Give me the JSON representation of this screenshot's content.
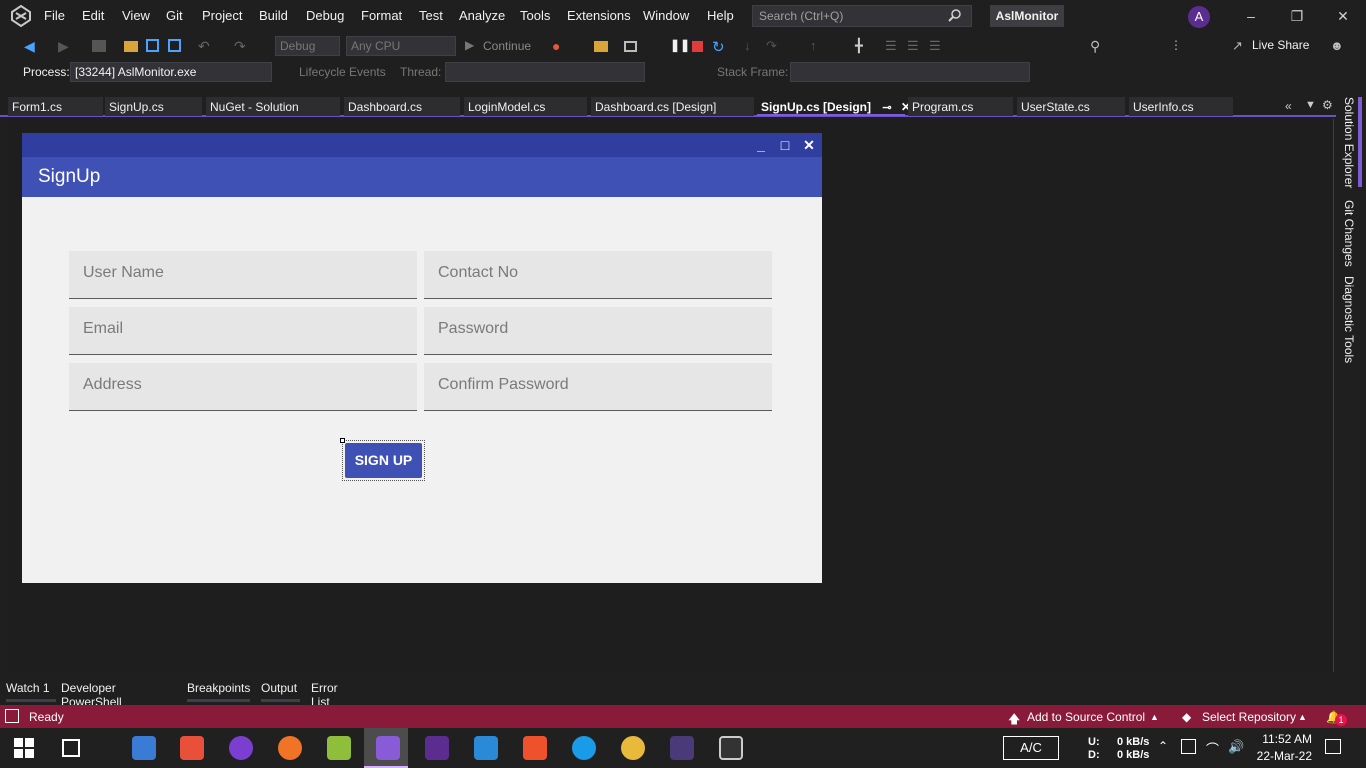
{
  "menu": {
    "items": [
      "File",
      "Edit",
      "View",
      "Git",
      "Project",
      "Build",
      "Debug",
      "Format",
      "Test",
      "Analyze",
      "Tools",
      "Extensions",
      "Window",
      "Help"
    ],
    "search_placeholder": "Search (Ctrl+Q)",
    "solution_name": "AslMonitor",
    "avatar_letter": "A"
  },
  "toolbar": {
    "config": "Debug",
    "platform": "Any CPU",
    "continue_label": "Continue",
    "live_share": "Live Share"
  },
  "debug_toolbar": {
    "process_label": "Process:",
    "process_value": "[33244] AslMonitor.exe",
    "lifecycle_label": "Lifecycle Events",
    "thread_label": "Thread:",
    "stack_label": "Stack Frame:"
  },
  "tabs": [
    {
      "label": "Form1.cs"
    },
    {
      "label": "SignUp.cs"
    },
    {
      "label": "NuGet - Solution"
    },
    {
      "label": "Dashboard.cs"
    },
    {
      "label": "LoginModel.cs"
    },
    {
      "label": "Dashboard.cs [Design]"
    },
    {
      "label": "SignUp.cs [Design]"
    },
    {
      "label": "Program.cs"
    },
    {
      "label": "UserState.cs"
    },
    {
      "label": "UserInfo.cs"
    }
  ],
  "form": {
    "title": "SignUp",
    "fields": {
      "username": "User Name",
      "contact": "Contact No",
      "email": "Email",
      "password": "Password",
      "address": "Address",
      "confirm_password": "Confirm Password"
    },
    "signup_button": "SIGN UP"
  },
  "side_panels": [
    "Solution Explorer",
    "Git Changes",
    "Diagnostic Tools"
  ],
  "bottom_tabs": [
    "Watch 1",
    "Developer PowerShell",
    "Breakpoints",
    "Output",
    "Error List"
  ],
  "status": {
    "text": "Ready",
    "source_control": "Add to Source Control",
    "repository": "Select Repository",
    "notifications": "1"
  },
  "taskbar": {
    "keyboard": "A/C",
    "upload_label": "U:",
    "download_label": "D:",
    "upload_rate": "0 kB/s",
    "download_rate": "0 kB/s",
    "time": "11:52 AM",
    "date": "22-Mar-22"
  },
  "colors": {
    "accent": "#7f5bd6",
    "form_header": "#3f51b5",
    "status_bar": "#8a1a3a"
  }
}
